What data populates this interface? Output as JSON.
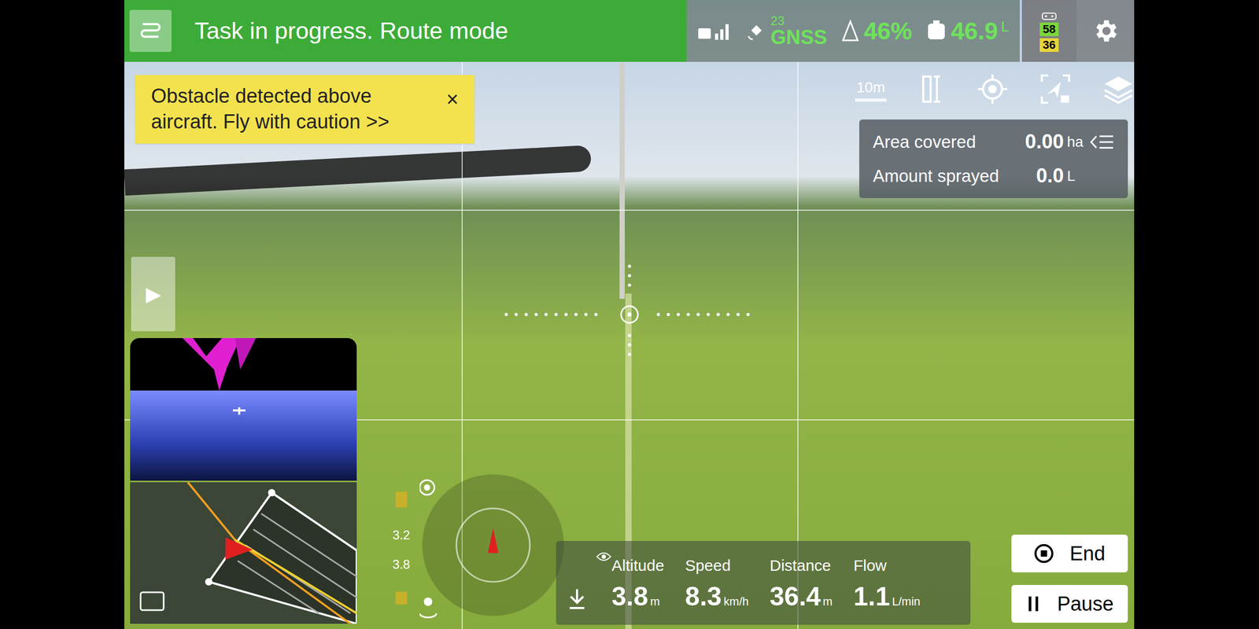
{
  "status_bar": {
    "title": "Task in progress. Route mode",
    "gnss_count": "23",
    "gnss_label": "GNSS",
    "battery": "46%",
    "tank": "46.9",
    "tank_unit": "L",
    "rc_levels": [
      "58",
      "36"
    ]
  },
  "alert": {
    "text": "Obstacle detected above aircraft. Fly with caution >>",
    "close": "×"
  },
  "toolbar": {
    "scale": "10m"
  },
  "stats": [
    {
      "label": "Area covered",
      "value": "0.00",
      "unit": "ha"
    },
    {
      "label": "Amount sprayed",
      "value": "0.0",
      "unit": "L"
    }
  ],
  "play": "▶",
  "altitude_scale": [
    "3.2",
    "3.8"
  ],
  "telemetry": [
    {
      "label": "Altitude",
      "value": "3.8",
      "unit": "m"
    },
    {
      "label": "Speed",
      "value": "8.3",
      "unit": "km/h"
    },
    {
      "label": "Distance",
      "value": "36.4",
      "unit": "m"
    },
    {
      "label": "Flow",
      "value": "1.1",
      "unit": "L/min"
    }
  ],
  "buttons": [
    {
      "label": "End"
    },
    {
      "label": "Pause"
    }
  ]
}
